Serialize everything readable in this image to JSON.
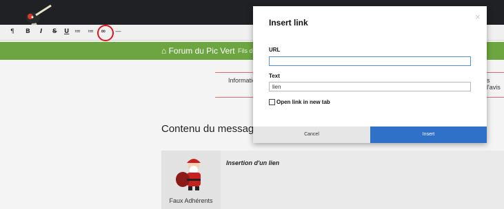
{
  "toolbar": {
    "buttons": [
      {
        "name": "paragraph",
        "glyph": "¶"
      },
      {
        "name": "bold",
        "glyph": "B"
      },
      {
        "name": "italic",
        "glyph": "I"
      },
      {
        "name": "strikethrough",
        "glyph": "S"
      },
      {
        "name": "underline",
        "glyph": "U"
      },
      {
        "name": "unordered-list",
        "glyph": "≔"
      },
      {
        "name": "ordered-list",
        "glyph": "≔"
      },
      {
        "name": "link",
        "glyph": "∞"
      },
      {
        "name": "horizontal-rule",
        "glyph": "—"
      }
    ]
  },
  "nav": {
    "home_label": "Forum du Pic Vert",
    "sub_label": "Fils d"
  },
  "content": {
    "info_tab": "Informatic",
    "avis_tab": "s l'avis",
    "section_title": "Contenu du message",
    "message": {
      "author": "Faux Adhérents",
      "title": "Insertion d'un lien"
    }
  },
  "modal": {
    "title": "Insert link",
    "close_glyph": "×",
    "url_label": "URL",
    "url_value": "",
    "text_label": "Text",
    "text_value": "lien",
    "checkbox_label": "Open link in new tab",
    "checkbox_checked": false,
    "cancel_label": "Cancel",
    "insert_label": "Insert"
  },
  "colors": {
    "header": "#1f2124",
    "nav_green": "#6da641",
    "insert_blue": "#2f71c8",
    "highlight_red": "#e0161b"
  }
}
